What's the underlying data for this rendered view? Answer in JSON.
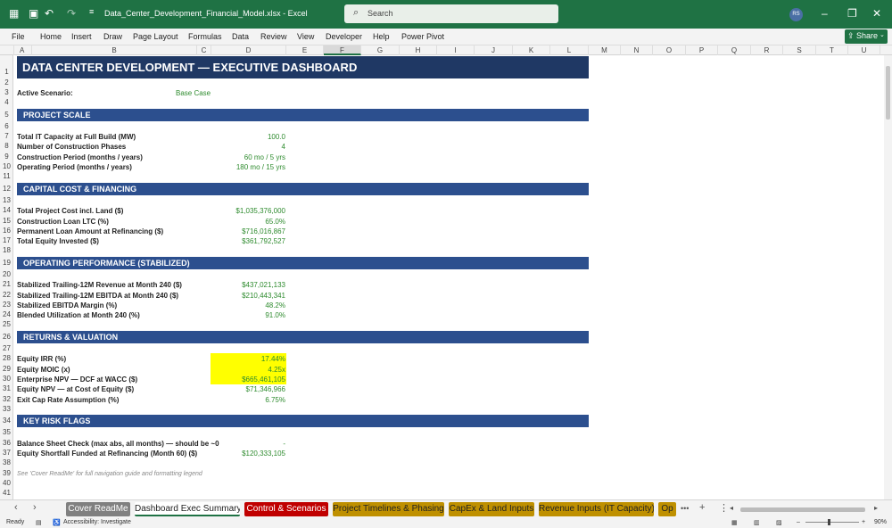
{
  "window": {
    "file_name": "Data_Center_Development_Financial_Model.xlsx  -  Excel",
    "search_placeholder": "Search",
    "avatar_initials": "RS"
  },
  "menu": [
    "File",
    "Home",
    "Insert",
    "Draw",
    "Page Layout",
    "Formulas",
    "Data",
    "Review",
    "View",
    "Developer",
    "Help",
    "Power Pivot"
  ],
  "share_label": "Share",
  "columns": [
    "A",
    "B",
    "C",
    "D",
    "E",
    "F",
    "G",
    "H",
    "I",
    "J",
    "K",
    "L",
    "M",
    "N",
    "O",
    "P",
    "Q",
    "R",
    "S",
    "T",
    "U"
  ],
  "selected_column": "F",
  "rows": [
    "1",
    "2",
    "3",
    "4",
    "5",
    "6",
    "7",
    "8",
    "9",
    "10",
    "11",
    "12",
    "13",
    "14",
    "15",
    "16",
    "17",
    "18",
    "19",
    "20",
    "21",
    "22",
    "23",
    "24",
    "25",
    "26",
    "27",
    "28",
    "29",
    "30",
    "31",
    "32",
    "33",
    "34",
    "35",
    "36",
    "37",
    "38",
    "39",
    "40",
    "41"
  ],
  "dashboard": {
    "title": "DATA CENTER DEVELOPMENT — EXECUTIVE DASHBOARD",
    "scenario_label": "Active Scenario:",
    "scenario_value": "Base Case",
    "sections": {
      "scale": "PROJECT SCALE",
      "capital": "CAPITAL COST & FINANCING",
      "operating": "OPERATING PERFORMANCE (STABILIZED)",
      "returns": "RETURNS & VALUATION",
      "risk": "KEY RISK FLAGS"
    },
    "scale_rows": [
      {
        "label": "Total IT Capacity at Full Build (MW)",
        "value": "100.0"
      },
      {
        "label": "Number of Construction Phases",
        "value": "4"
      },
      {
        "label": "Construction Period (months / years)",
        "value": "60 mo / 5 yrs"
      },
      {
        "label": "Operating Period (months / years)",
        "value": "180 mo / 15 yrs"
      }
    ],
    "capital_rows": [
      {
        "label": "Total Project Cost incl. Land ($)",
        "value": "$1,035,376,000"
      },
      {
        "label": "Construction Loan LTC (%)",
        "value": "65.0%"
      },
      {
        "label": "Permanent Loan Amount at Refinancing ($)",
        "value": "$716,016,867"
      },
      {
        "label": "Total Equity Invested ($)",
        "value": "$361,792,527"
      }
    ],
    "operating_rows": [
      {
        "label": "Stabilized Trailing-12M Revenue at Month 240 ($)",
        "value": "$437,021,133"
      },
      {
        "label": "Stabilized Trailing-12M EBITDA at Month 240 ($)",
        "value": "$210,443,341"
      },
      {
        "label": "Stabilized EBITDA Margin (%)",
        "value": "48.2%"
      },
      {
        "label": "Blended Utilization at Month 240 (%)",
        "value": "91.0%"
      }
    ],
    "returns_rows": [
      {
        "label": "Equity IRR (%)",
        "value": "17.44%"
      },
      {
        "label": "Equity MOIC (x)",
        "value": "4.25x"
      },
      {
        "label": "Enterprise NPV — DCF at WACC ($)",
        "value": "$665,461,105"
      },
      {
        "label": "Equity NPV — at Cost of Equity ($)",
        "value": "$71,346,966"
      },
      {
        "label": "Exit Cap Rate Assumption (%)",
        "value": "6.75%"
      }
    ],
    "risk_rows": [
      {
        "label": "Balance Sheet Check (max abs, all months) — should be ~0",
        "value": "-"
      },
      {
        "label": "Equity Shortfall Funded at Refinancing (Month 60) ($)",
        "value": "$120,333,105"
      }
    ],
    "note": "See 'Cover ReadMe' for full navigation guide and formatting legend"
  },
  "tabs": [
    {
      "label": "Cover ReadMe",
      "bg": "#808080",
      "fg": "#ffffff"
    },
    {
      "label": "Dashboard Exec Summary",
      "bg": "#ffffff",
      "fg": "#222222"
    },
    {
      "label": "Control & Scenarios",
      "bg": "#c00000",
      "fg": "#ffffff"
    },
    {
      "label": "Project Timelines & Phasing",
      "bg": "#bf9000",
      "fg": "#222222"
    },
    {
      "label": "CapEx & Land Inputs",
      "bg": "#bf9000",
      "fg": "#222222"
    },
    {
      "label": "Revenue Inputs (IT Capacity)",
      "bg": "#bf9000",
      "fg": "#222222"
    },
    {
      "label": "Op",
      "bg": "#bf9000",
      "fg": "#222222"
    }
  ],
  "status": {
    "ready": "Ready",
    "accessibility": "Accessibility: Investigate",
    "zoom": "90%"
  }
}
